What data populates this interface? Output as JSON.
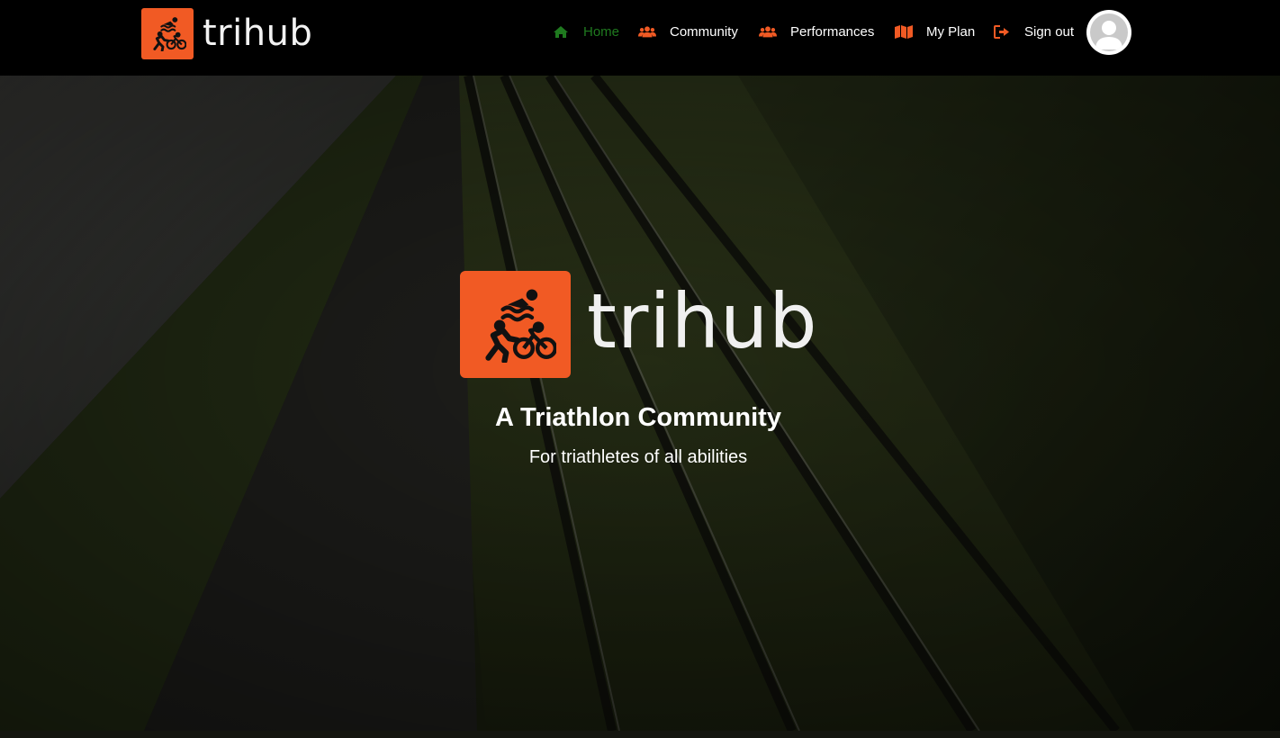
{
  "brand": {
    "name": "trihub",
    "accent_color": "#f15a24",
    "logo_icon": "triathlon-icon"
  },
  "nav": {
    "items": [
      {
        "label": "Home",
        "icon": "home-icon",
        "active": true
      },
      {
        "label": "Community",
        "icon": "users-icon",
        "active": false
      },
      {
        "label": "Performances",
        "icon": "users-icon",
        "active": false
      },
      {
        "label": "My Plan",
        "icon": "map-icon",
        "active": false
      },
      {
        "label": "Sign out",
        "icon": "sign-out-icon",
        "active": false
      }
    ],
    "active_color": "#1f7a1f",
    "icon_color": "#f15a24",
    "avatar_icon": "user-avatar-icon"
  },
  "hero": {
    "brand_name": "trihub",
    "title": "A Triathlon Community",
    "subtitle": "For triathletes of all abilities"
  }
}
